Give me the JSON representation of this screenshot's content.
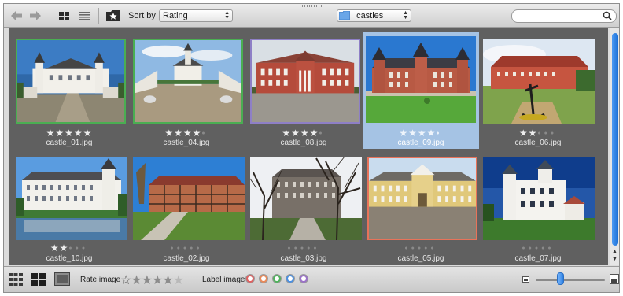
{
  "toolbar": {
    "back_icon": "arrow-left-icon",
    "forward_icon": "arrow-right-icon",
    "grid_view_icon": "grid-view-icon",
    "list_view_icon": "list-view-icon",
    "favorite_folder_icon": "star-folder-icon",
    "sort_label": "Sort by",
    "sort_value": "Rating",
    "folder_icon": "folder-icon",
    "folder_value": "castles",
    "search_placeholder": "",
    "search_icon": "search-icon"
  },
  "photos": [
    {
      "filename": "castle_01.jpg",
      "rating": 5,
      "label": "green",
      "selected": false,
      "scene": "white castle with towers, cobbled drive"
    },
    {
      "filename": "castle_04.jpg",
      "rating": 4,
      "label": "green",
      "selected": false,
      "scene": "white manor courtyard, wide angle"
    },
    {
      "filename": "castle_08.jpg",
      "rating": 4,
      "label": "purple",
      "selected": false,
      "scene": "red brick manor with gravel forecourt"
    },
    {
      "filename": "castle_09.jpg",
      "rating": 4,
      "label": "none",
      "selected": true,
      "scene": "red brick manor with towers and lawn"
    },
    {
      "filename": "castle_06.jpg",
      "rating": 2,
      "label": "none",
      "selected": false,
      "scene": "red building with anchor sculpture"
    },
    {
      "filename": "castle_10.jpg",
      "rating": 2,
      "label": "none",
      "selected": false,
      "scene": "white palace reflected in lake"
    },
    {
      "filename": "castle_02.jpg",
      "rating": 0,
      "label": "none",
      "selected": false,
      "scene": "half-timbered building with lawn"
    },
    {
      "filename": "castle_03.jpg",
      "rating": 0,
      "label": "none",
      "selected": false,
      "scene": "grey castle behind bare trees"
    },
    {
      "filename": "castle_05.jpg",
      "rating": 0,
      "label": "red",
      "selected": false,
      "scene": "yellow palace with cobbled square"
    },
    {
      "filename": "castle_07.jpg",
      "rating": 0,
      "label": "none",
      "selected": false,
      "scene": "white villa with dark blue sky"
    }
  ],
  "bottombar": {
    "view_icons": [
      "small-grid-icon",
      "medium-grid-icon",
      "large-thumb-icon"
    ],
    "rate_label": "Rate image",
    "label_label": "Label image",
    "label_colors": [
      "#e06060",
      "#e88a5a",
      "#4fb35c",
      "#4a90e2",
      "#9b72c8"
    ],
    "zoom_level": 0.35,
    "zoom_small_icon": "small-image-icon",
    "zoom_large_icon": "large-image-icon"
  },
  "colors": {
    "green": "#4aae52",
    "purple": "#8e7fc6",
    "red": "#e8735a",
    "selection": "#a5c3e4",
    "accent": "#1a6fd6"
  }
}
